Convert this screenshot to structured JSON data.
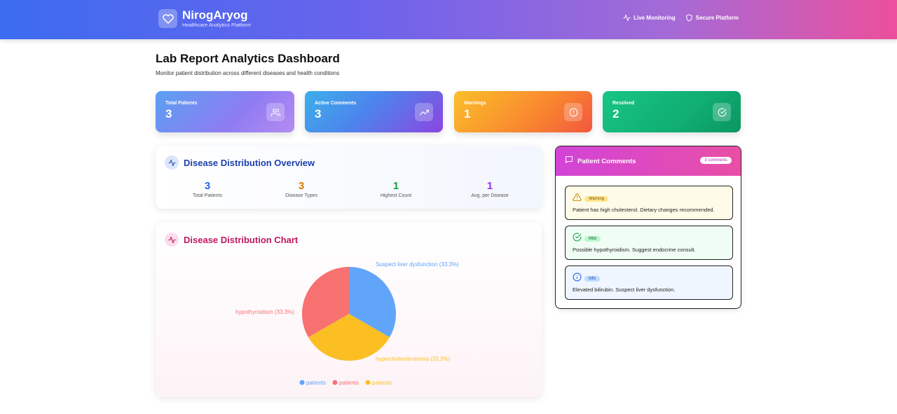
{
  "header": {
    "brand_name": "NirogAryog",
    "brand_subtitle": "Healthcare Analytics Platform",
    "nav": [
      {
        "label": "Live Monitoring",
        "icon": "activity-icon"
      },
      {
        "label": "Secure Platform",
        "icon": "shield-icon"
      }
    ]
  },
  "page": {
    "title": "Lab Report Analytics Dashboard",
    "subtitle": "Monitor patient distribution across different diseases and health conditions"
  },
  "stats": [
    {
      "label": "Total Patients",
      "value": "3",
      "icon": "users-icon"
    },
    {
      "label": "Active Comments",
      "value": "3",
      "icon": "trending-up-icon"
    },
    {
      "label": "Warnings",
      "value": "1",
      "icon": "alert-circle-icon"
    },
    {
      "label": "Resolved",
      "value": "2",
      "icon": "check-circle-icon"
    }
  ],
  "overview": {
    "title": "Disease Distribution Overview",
    "items": [
      {
        "value": "3",
        "label": "Total Patients",
        "color": "#2563eb"
      },
      {
        "value": "3",
        "label": "Disease Types",
        "color": "#d97706"
      },
      {
        "value": "1",
        "label": "Highest Count",
        "color": "#16a34a"
      },
      {
        "value": "1",
        "label": "Avg. per Disease",
        "color": "#9333ea"
      }
    ]
  },
  "chart": {
    "title": "Disease Distribution Chart"
  },
  "chart_data": {
    "type": "pie",
    "slices": [
      {
        "name": "Suspect liver dysfunction",
        "value": 1,
        "percent": "33.3%",
        "color": "#60a5fa"
      },
      {
        "name": "hypercholesterolemia",
        "value": 1,
        "percent": "33.3%",
        "color": "#fbbf24"
      },
      {
        "name": "hypothyroidism",
        "value": 1,
        "percent": "33.3%",
        "color": "#f87171"
      }
    ],
    "labels": [
      "Suspect liver dysfunction (33.3%)",
      "hypercholesterolemia (33.3%)",
      "hypothyroidism (33.3%)"
    ],
    "legend": [
      {
        "label": "patients",
        "color": "#60a5fa"
      },
      {
        "label": "patients",
        "color": "#f87171"
      },
      {
        "label": "patients",
        "color": "#fbbf24"
      }
    ],
    "legend_position": "bottom"
  },
  "comments": {
    "title": "Patient Comments",
    "count_label": "3 comments",
    "items": [
      {
        "badge": "Warning",
        "text": "Patient has high cholesterol. Dietary changes recommended.",
        "icon": "warning-triangle-icon",
        "bg": "#fefce8",
        "badge_bg": "#fde68a",
        "badge_color": "#854d0e",
        "icon_color": "#ca8a04"
      },
      {
        "badge": "Mild",
        "text": "Possible hypothyroidism. Suggest endocrine consult.",
        "icon": "check-circle-icon",
        "bg": "#f0fdf4",
        "badge_bg": "#bbf7d0",
        "badge_color": "#166534",
        "icon_color": "#16a34a"
      },
      {
        "badge": "Info",
        "text": "Elevated bilirubin. Suspect liver dysfunction.",
        "icon": "info-circle-icon",
        "bg": "#eff6ff",
        "badge_bg": "#bfdbfe",
        "badge_color": "#1e40af",
        "icon_color": "#2563eb"
      }
    ]
  }
}
